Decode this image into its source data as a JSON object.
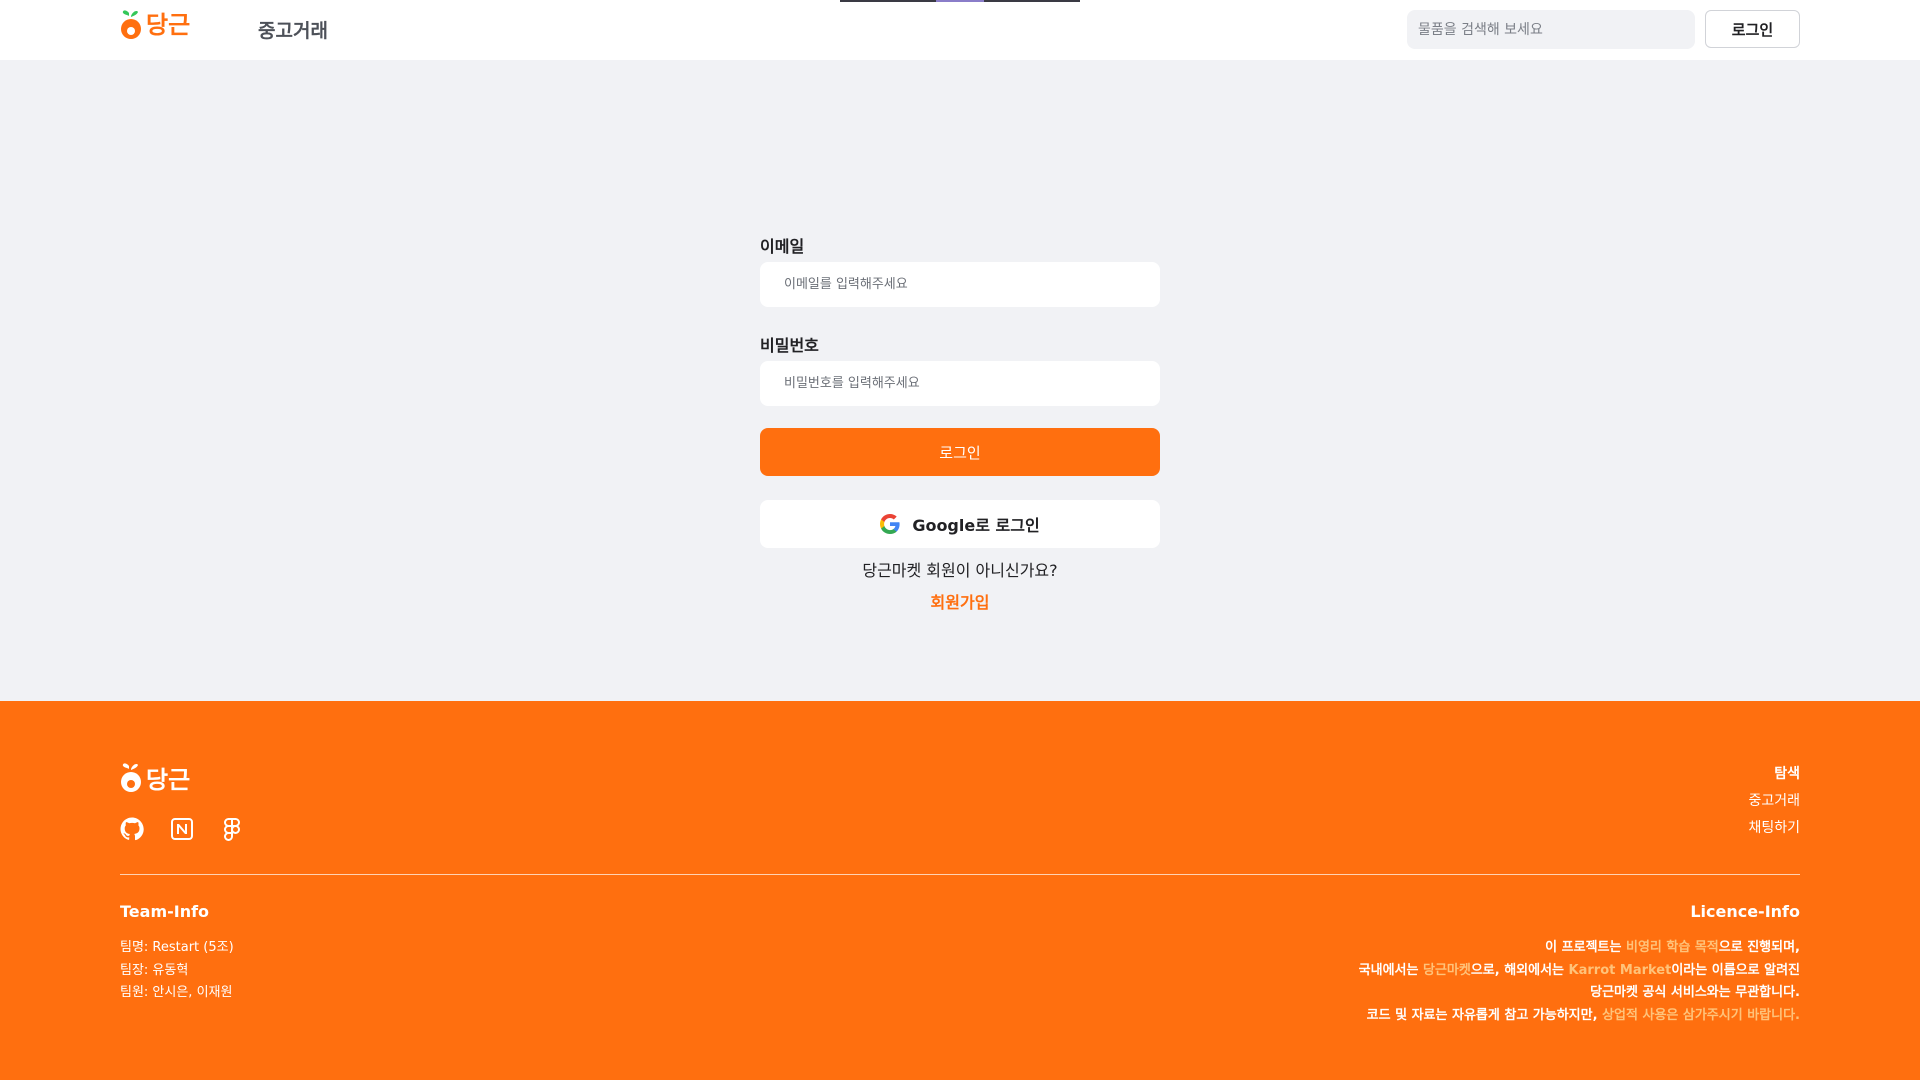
{
  "header": {
    "logo_text": "당근",
    "nav_label": "중고거래",
    "search_placeholder": "물품을 검색해 보세요",
    "login_label": "로그인"
  },
  "form": {
    "email_label": "이메일",
    "email_placeholder": "이메일를 입력해주세요",
    "password_label": "비밀번호",
    "password_placeholder": "비밀번호를 입력해주세요",
    "login_button": "로그인",
    "google_button": "Google로 로그인",
    "not_member_text": "당근마켓 회원이 아니신가요?",
    "signup_link": "회원가입"
  },
  "footer": {
    "logo_text": "당근",
    "social_icons": [
      "github-icon",
      "notion-icon",
      "figma-icon"
    ],
    "nav": [
      "탐색",
      "중고거래",
      "채팅하기"
    ],
    "team_title": "Team-Info",
    "team_lines": [
      "팀명: Restart (5조)",
      "팀장: 유동혁",
      "팀원: 안시은, 이재원"
    ],
    "licence_title": "Licence-Info",
    "licence": {
      "l1_a": "이 프로젝트는 ",
      "l1_b": "비영리 학습 목적",
      "l1_c": "으로 진행되며,",
      "l2_a": "국내에서는 ",
      "l2_b": "당근마켓",
      "l2_c": "으로, 해외에서는 ",
      "l2_d": "Karrot Market",
      "l2_e": "이라는 이름으로 알려진",
      "l3": "당근마켓 공식 서비스와는 무관합니다.",
      "l4_a": "코드 및 자료는 자유롭게 참고 가능하지만, ",
      "l4_b": "상업적 사용은 삼가주시기 바랍니다."
    }
  },
  "colors": {
    "brand": "#ff6f0f",
    "page_bg": "#f1f2f5",
    "highlight": "#ffc37a"
  }
}
